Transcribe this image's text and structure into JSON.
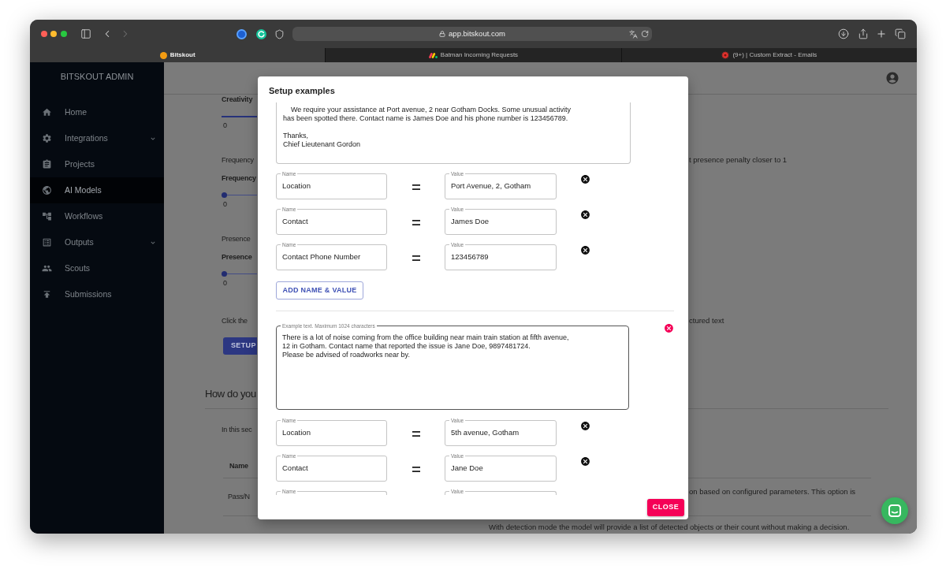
{
  "browser": {
    "url": "app.bitskout.com",
    "tabs": [
      {
        "title": "Bitskout",
        "selected": true
      },
      {
        "title": "Batman Incoming Requests",
        "selected": false
      },
      {
        "title": "(9+) | Custom Extract - Emails",
        "selected": false
      }
    ]
  },
  "sidebar": {
    "title": "BITSKOUT ADMIN",
    "items": [
      {
        "label": "Home",
        "selected": false,
        "expandable": false
      },
      {
        "label": "Integrations",
        "selected": false,
        "expandable": true
      },
      {
        "label": "Projects",
        "selected": false,
        "expandable": false
      },
      {
        "label": "AI Models",
        "selected": true,
        "expandable": false
      },
      {
        "label": "Workflows",
        "selected": false,
        "expandable": false
      },
      {
        "label": "Outputs",
        "selected": false,
        "expandable": true
      },
      {
        "label": "Scouts",
        "selected": false,
        "expandable": false
      },
      {
        "label": "Submissions",
        "selected": false,
        "expandable": false
      }
    ]
  },
  "page": {
    "parameters": [
      {
        "label": "Creativity",
        "level": 1,
        "min": "0"
      },
      {
        "description": "Frequency",
        "description_end": "t presence penalty closer to 1",
        "label": "Frequency",
        "level": 0,
        "min": "0"
      },
      {
        "description": "Presence",
        "label": "Presence",
        "level": 0,
        "min": "0"
      }
    ],
    "setup": {
      "text": "Click the",
      "text_end": "ctured text",
      "button": "SETUP"
    },
    "section": {
      "title": "How do you",
      "intro": "In this sec",
      "columns": [
        "Name"
      ],
      "rows": [
        {
          "name": "Pass/N",
          "description": "on based on configured parameters. This option is"
        },
        {
          "description": "With detection mode the model will provide a list of detected objects or their count without making a decision."
        }
      ]
    }
  },
  "dialog": {
    "title": "Setup examples",
    "examples": [
      {
        "text": "\tWe require your assistance at Port avenue, 2 near Gotham Docks. Some unusual activity\nhas been spotted there. Contact name is James Doe and his phone number is 123456789.\n\nThanks,\nChief Lieutenant Gordon",
        "hovered": false,
        "pairs": [
          {
            "name_label": "Name",
            "name": "Location",
            "value_label": "Value",
            "value": "Port Avenue, 2, Gotham"
          },
          {
            "name_label": "Name",
            "name": "Contact",
            "value_label": "Value",
            "value": "James Doe"
          },
          {
            "name_label": "Name",
            "name": "Contact Phone Number",
            "value_label": "Value",
            "value": "123456789"
          }
        ],
        "add_button": "ADD NAME & VALUE"
      },
      {
        "label": "Example text. Maximum 1024 characters",
        "text": "There is a lot of noise coming from the office building near main train station at fifth avenue,\n12 in Gotham. Contact name that reported the issue is Jane Doe, 9897481724.\nPlease be advised of roadworks near by.",
        "hovered": true,
        "pairs": [
          {
            "name_label": "Name",
            "name": "Location",
            "value_label": "Value",
            "value": "5th avenue, Gotham"
          },
          {
            "name_label": "Name",
            "name": "Contact",
            "value_label": "Value",
            "value": "Jane Doe"
          },
          {
            "name_label": "Name",
            "value_label": "Value"
          }
        ]
      }
    ],
    "close_button": "CLOSE"
  }
}
